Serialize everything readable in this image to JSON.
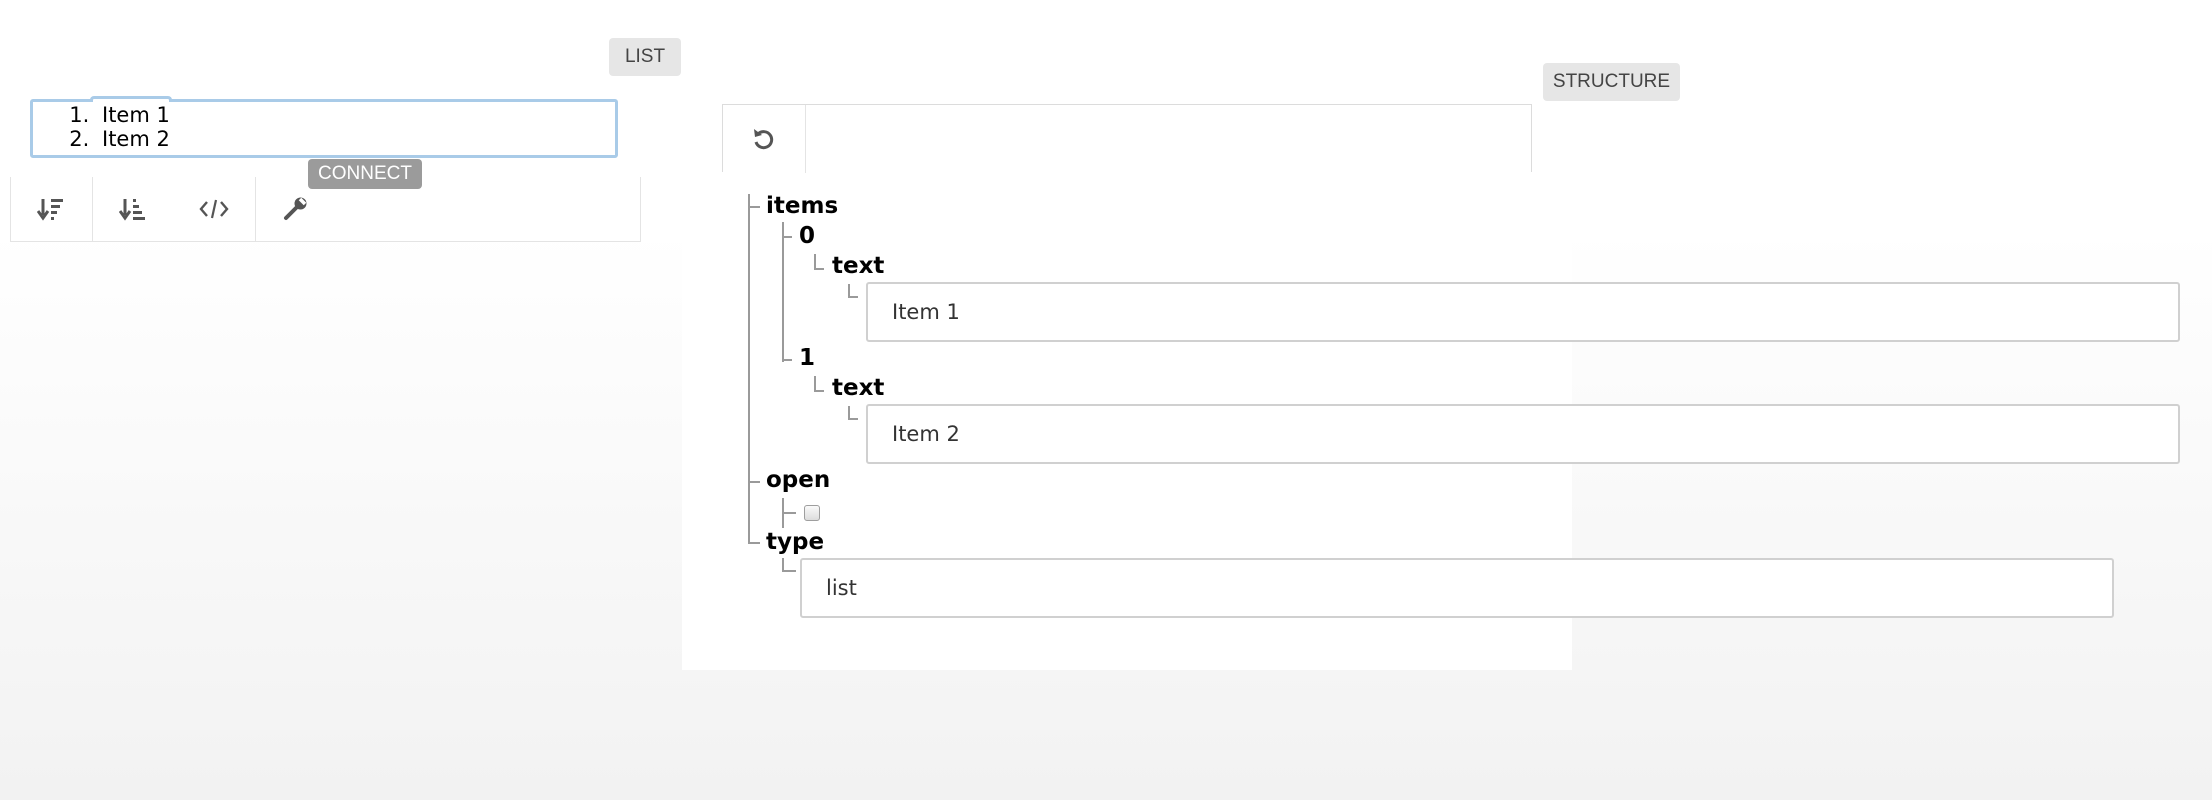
{
  "list_panel": {
    "tab_label": "LIST",
    "items": [
      "Item 1",
      "Item 2"
    ],
    "connect_label": "CONNECT",
    "toolbar_icons": [
      "sort-descending-icon",
      "sort-ascending-icon",
      "code-icon",
      "wrench-icon"
    ]
  },
  "structure_panel": {
    "tab_label": "STRUCTURE",
    "toolbar_icons": [
      "undo-icon"
    ],
    "tree": {
      "items_key": "items",
      "item0_key": "0",
      "item0_text_key": "text",
      "item0_text_value": "Item 1",
      "item1_key": "1",
      "item1_text_key": "text",
      "item1_text_value": "Item 2",
      "open_key": "open",
      "open_value": false,
      "type_key": "type",
      "type_value": "list"
    }
  },
  "colors": {
    "focus_border": "#a9cbe8",
    "connect_badge": "#9b9b9b",
    "tag_button": "#e6e6e6",
    "tree_line": "#9a9a9a"
  }
}
